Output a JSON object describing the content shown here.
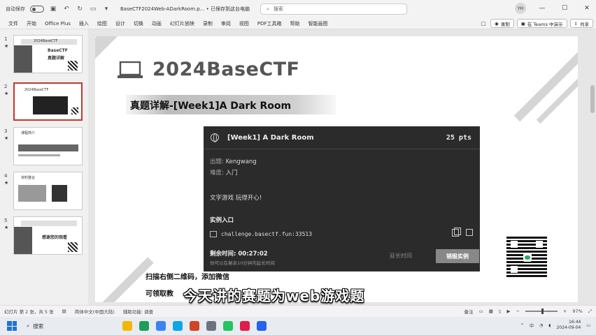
{
  "titlebar": {
    "autosave_label": "自动保存",
    "doc_title": "BaseCTF2024Web-ADarkRoom.p... • 已保存到这台电脑",
    "search_placeholder": "搜索",
    "avatar_initials": "YH"
  },
  "ribbon": {
    "tabs": [
      "文件",
      "开始",
      "Office Plus",
      "插入",
      "绘图",
      "设计",
      "切换",
      "动画",
      "幻灯片放映",
      "录制",
      "审阅",
      "视图",
      "PDF工具箱",
      "帮助",
      "智能画图"
    ],
    "record_label": "录制",
    "teams_label": "在 Teams 中演示",
    "share_label": "共享"
  },
  "thumbnails": [
    {
      "num": "1",
      "line1": "2024BaseCTF",
      "line2": "BaseCTF",
      "line3": "真题详解"
    },
    {
      "num": "2",
      "line1": "2024BaseCTF"
    },
    {
      "num": "3",
      "line1": "课程简介"
    },
    {
      "num": "4",
      "line1": "资料整合"
    },
    {
      "num": "5",
      "line1": "感谢您的观看"
    }
  ],
  "slide": {
    "title": "2024BaseCTF",
    "subtitle": "真题详解-[Week1]A Dark Room",
    "scan_line1": "扫描右侧二维码，添加微信",
    "scan_line2": "可领取教",
    "caption": "今天讲的赛题为web游戏题"
  },
  "card": {
    "title": "[Week1] A Dark Room",
    "points": "25 pts",
    "author_key": "出题:",
    "author": "Kengwang",
    "difficulty_key": "难度:",
    "difficulty": "入门",
    "description": "文字游戏 玩得开心!",
    "instance_heading": "实例入口",
    "instance_url": "challenge.basectf.fun:33513",
    "timer_label": "剩余时间:",
    "timer_value": "00:27:02",
    "timer_hint": "你可以在剩余10分钟内延长时间",
    "extend_label": "延长时间",
    "destroy_label": "销毁实例"
  },
  "statusbar": {
    "slide_info": "幻灯片 第 2 张，共 5 张",
    "language": "简体中文(中国大陆)",
    "accessibility": "辅助功能: 调查",
    "notes": "备注",
    "zoom": "97%",
    "zoom_fraction": 0.5
  },
  "taskbar": {
    "search": "搜索",
    "time": "16:44",
    "date": "2024-09-04",
    "ime": "中"
  },
  "colors": {
    "accent_red": "#c0392b",
    "card_bg": "#2b2b2b",
    "windows_blue": "#1e73d6"
  }
}
